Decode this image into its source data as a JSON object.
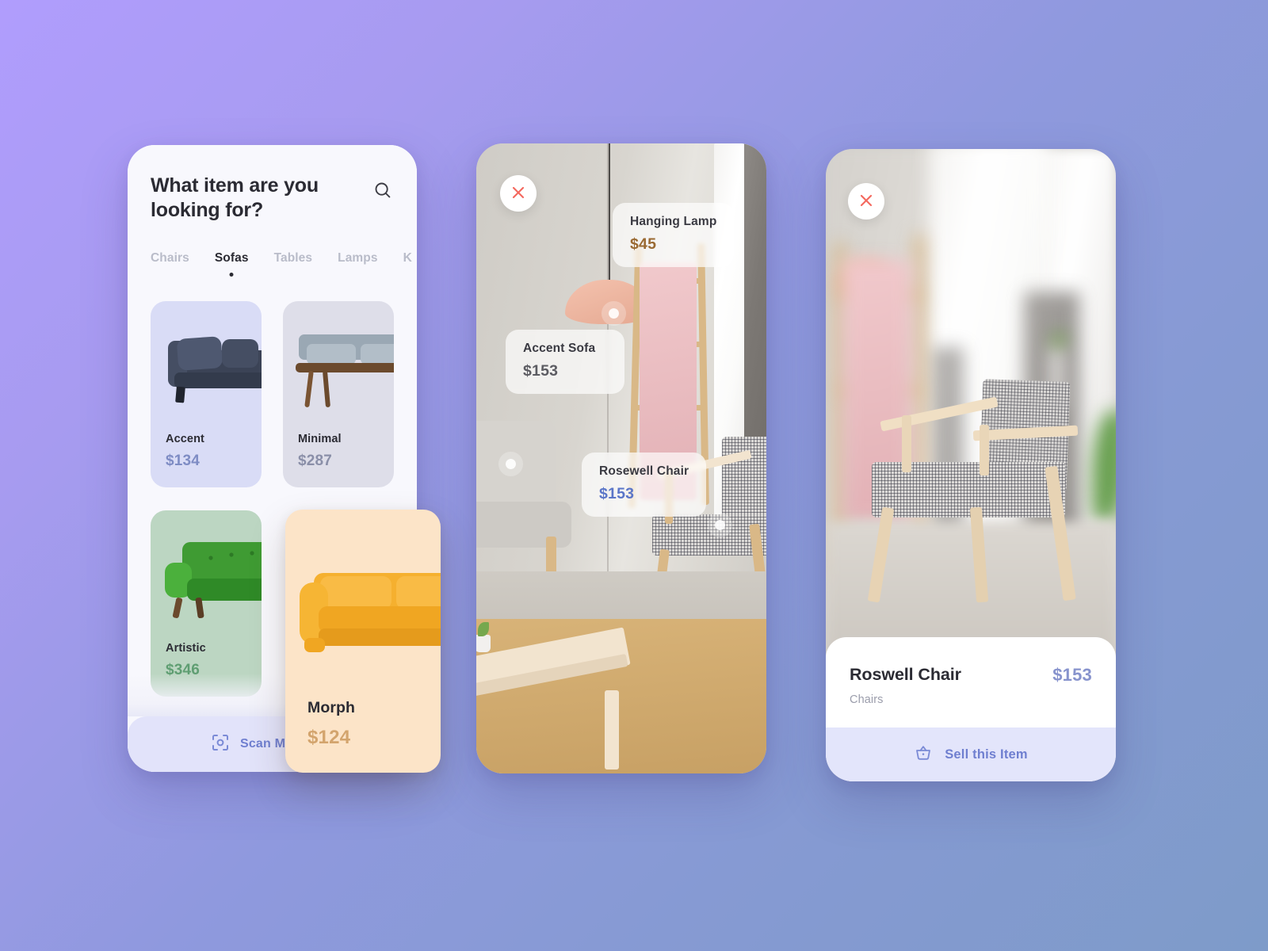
{
  "background": {
    "from": "#b09dfd",
    "to": "#7e9bc9"
  },
  "catalog": {
    "title": "What item are you looking for?",
    "search_icon": "search-icon",
    "tabs": [
      {
        "label": "Chairs",
        "active": false
      },
      {
        "label": "Sofas",
        "active": true
      },
      {
        "label": "Tables",
        "active": false
      },
      {
        "label": "Lamps",
        "active": false
      },
      {
        "label": "K",
        "active": false
      }
    ],
    "products": [
      {
        "name": "Accent",
        "price": "$134",
        "bg": "#d9dcf6",
        "price_color": "#7e8cc4"
      },
      {
        "name": "Minimal",
        "price": "$287",
        "bg": "#dedee9",
        "price_color": "#8a8fa8"
      },
      {
        "name": "Artistic",
        "price": "$346",
        "bg": "#bcd6c2",
        "price_color": "#5f9e72"
      },
      {
        "name": "Morph",
        "price": "$124",
        "bg": "#fce4c8",
        "price_color": "#d3a46d"
      }
    ],
    "scan": {
      "label": "Scan My Room",
      "icon": "scan-icon",
      "bg": "#e2e3fa",
      "color": "#6f7fd0"
    }
  },
  "ar_view": {
    "close_icon": "close-icon",
    "tags": [
      {
        "name": "Hanging Lamp",
        "price": "$45",
        "price_color": "#9a6a33"
      },
      {
        "name": "Accent Sofa",
        "price": "$153",
        "price_color": "#5c5c62"
      },
      {
        "name": "Rosewell Chair",
        "price": "$153",
        "price_color": "#5b76c8"
      }
    ]
  },
  "detail_view": {
    "close_icon": "close-icon",
    "product": {
      "name": "Roswell Chair",
      "price": "$153",
      "category": "Chairs",
      "price_color": "#8793cd"
    },
    "sell": {
      "label": "Sell this Item",
      "icon": "basket-icon",
      "bg": "#e3e5fb",
      "color": "#6f7fd0"
    }
  }
}
